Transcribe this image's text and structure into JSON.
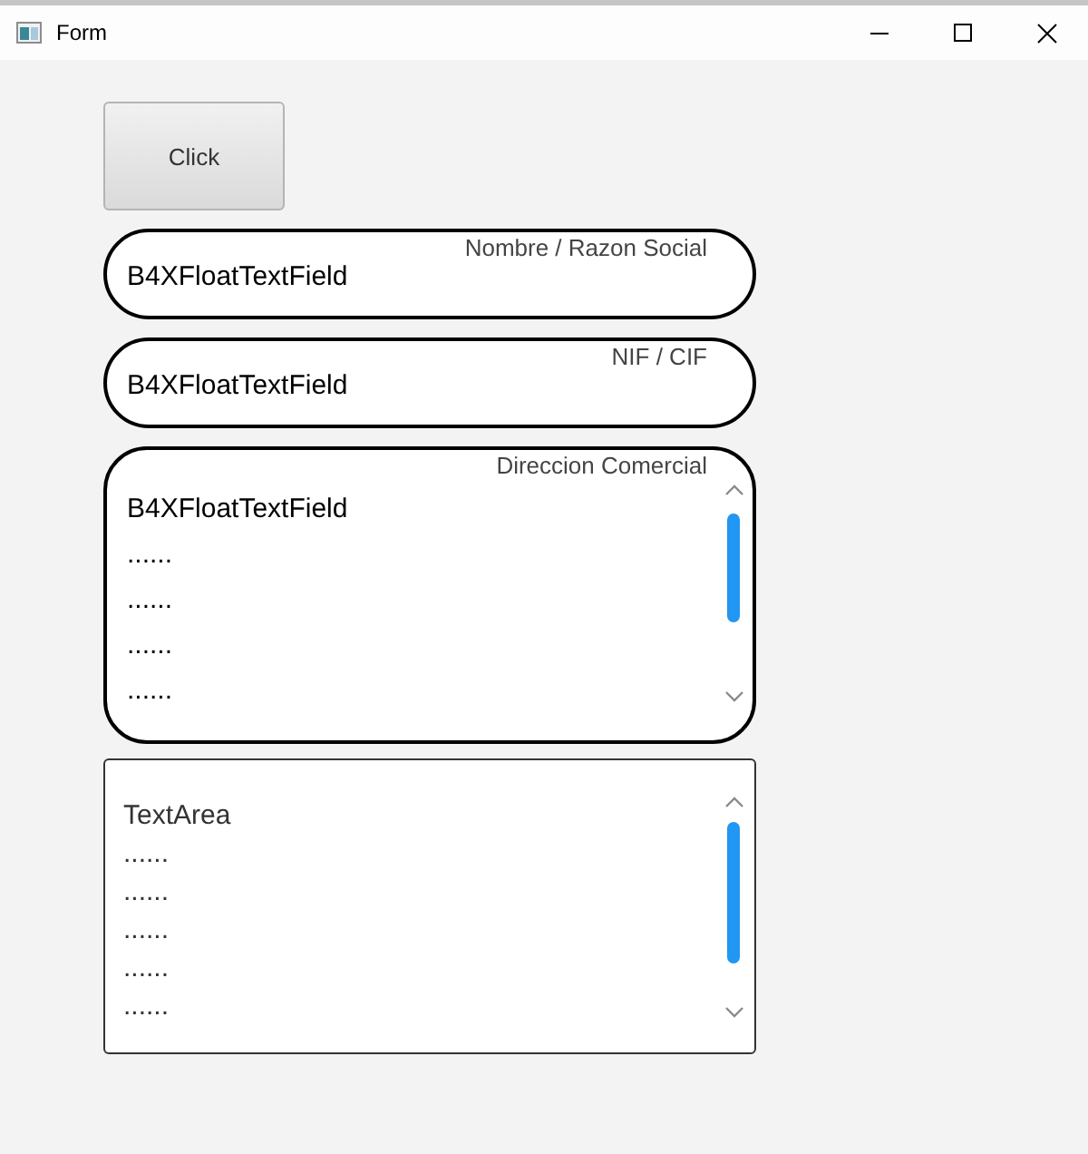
{
  "window": {
    "title": "Form"
  },
  "button": {
    "label": "Click"
  },
  "fields": [
    {
      "kind": "single",
      "label": "Nombre / Razon Social",
      "value": "B4XFloatTextField"
    },
    {
      "kind": "single",
      "label": "NIF / CIF",
      "value": "B4XFloatTextField"
    },
    {
      "kind": "multi",
      "label": "Direccion Comercial",
      "lines": [
        "B4XFloatTextField",
        "......",
        "......",
        "......",
        "......"
      ]
    }
  ],
  "text_area": {
    "lines": [
      "TextArea",
      "......",
      "......",
      "......",
      "......",
      "......"
    ]
  }
}
